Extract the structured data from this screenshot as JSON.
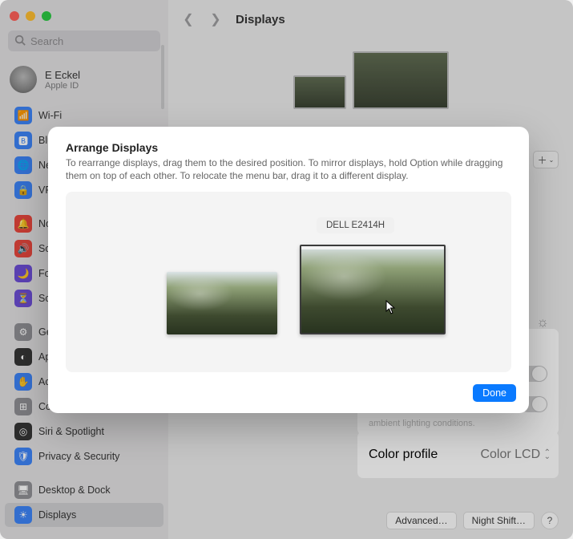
{
  "window": {
    "title": "Displays"
  },
  "search": {
    "placeholder": "Search"
  },
  "user": {
    "name": "E Eckel",
    "sub": "Apple ID"
  },
  "sidebar": {
    "groups": [
      [
        {
          "icon": "📶",
          "color": "#3a82f7",
          "label": "Wi-Fi"
        },
        {
          "icon": "🅱",
          "color": "#3a82f7",
          "label": "Bluetooth"
        },
        {
          "icon": "🌐",
          "color": "#3a82f7",
          "label": "Network"
        },
        {
          "icon": "🔒",
          "color": "#3a82f7",
          "label": "VPN"
        }
      ],
      [
        {
          "icon": "🔔",
          "color": "#e8443a",
          "label": "Notifications"
        },
        {
          "icon": "🔊",
          "color": "#e8443a",
          "label": "Sound"
        },
        {
          "icon": "🌙",
          "color": "#6b4bd6",
          "label": "Focus"
        },
        {
          "icon": "⏳",
          "color": "#6b4bd6",
          "label": "Screen Time"
        }
      ],
      [
        {
          "icon": "⚙",
          "color": "#8e8e93",
          "label": "General"
        },
        {
          "icon": "◐",
          "color": "#323232",
          "label": "Appearance"
        },
        {
          "icon": "✋",
          "color": "#3a82f7",
          "label": "Accessibility"
        },
        {
          "icon": "⊞",
          "color": "#8e8e93",
          "label": "Control Center"
        },
        {
          "icon": "◎",
          "color": "#323232",
          "label": "Siri & Spotlight"
        },
        {
          "icon": "🛡",
          "color": "#3a82f7",
          "label": "Privacy & Security"
        }
      ],
      [
        {
          "icon": "🖥",
          "color": "#8e8e93",
          "label": "Desktop & Dock"
        },
        {
          "icon": "☀",
          "color": "#3a82f7",
          "label": "Displays",
          "selected": true
        }
      ]
    ]
  },
  "main": {
    "truncated_line": "ambient lighting conditions.",
    "color_profile_label": "Color profile",
    "color_profile_value": "Color LCD",
    "advanced": "Advanced…",
    "night_shift": "Night Shift…"
  },
  "modal": {
    "heading": "Arrange Displays",
    "body": "To rearrange displays, drag them to the desired position. To mirror displays, hold Option while dragging them on top of each other. To relocate the menu bar, drag it to a different display.",
    "tooltip": "DELL E2414H",
    "done": "Done"
  }
}
